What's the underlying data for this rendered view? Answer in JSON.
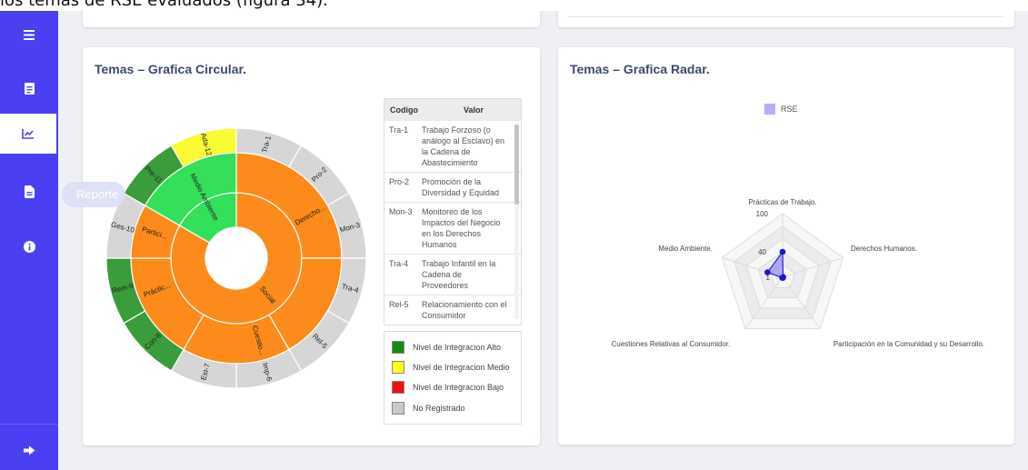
{
  "document": {
    "top_text": "los temas de RSE evaluados (figura 34)."
  },
  "sidebar": {
    "items": [
      {
        "icon": "menu-icon"
      },
      {
        "icon": "clipboard-icon"
      },
      {
        "icon": "chart-line-icon",
        "active": true
      },
      {
        "icon": "file-icon"
      },
      {
        "icon": "info-icon"
      }
    ],
    "logout_icon": "sign-out-icon",
    "tooltip": "Reporte"
  },
  "circular_card": {
    "title": "Temas – Grafica Circular.",
    "legend_table": {
      "headers": {
        "code": "Codigo",
        "value": "Valor"
      },
      "rows": [
        {
          "code": "Tra-1",
          "value": "Trabajo Forzoso (o análogo al Esclavo) en la Cadena de Abastecimiento"
        },
        {
          "code": "Pro-2",
          "value": "Promoción de la Diversidad y Equidad"
        },
        {
          "code": "Mon-3",
          "value": "Monitoreo de los Impactos del Negocio en los Derechos Humanos"
        },
        {
          "code": "Tra-4",
          "value": "Trabajo Infantil en la Cadena de Proveedores"
        },
        {
          "code": "Rel-5",
          "value": "Relacionamiento con el Consumidor"
        }
      ]
    },
    "levels": [
      {
        "label": "Nivel de Integracion Alto",
        "color": "#138a13"
      },
      {
        "label": "Nivel de Integracion Medio",
        "color": "#ffff22"
      },
      {
        "label": "Nivel de Integracion Bajo",
        "color": "#ee1111"
      },
      {
        "label": "No Registrado",
        "color": "#c8c8c8"
      }
    ],
    "inner_ring": [
      {
        "label": "Social"
      }
    ],
    "middle_ring": [
      {
        "label": "Medio Ambiente"
      },
      {
        "label": "Derecho..."
      },
      {
        "label": "Cuestio..."
      },
      {
        "label": "Práctic..."
      },
      {
        "label": "Partici..."
      }
    ],
    "outer_ring": [
      {
        "label": "Tra-1"
      },
      {
        "label": "Pro-2"
      },
      {
        "label": "Mon-3"
      },
      {
        "label": "Tra-4"
      },
      {
        "label": "Rel-5"
      },
      {
        "label": "Imp-6"
      },
      {
        "label": "Est-7"
      },
      {
        "label": "Con-8"
      },
      {
        "label": "Rem-9"
      },
      {
        "label": "Ges-10"
      },
      {
        "label": "Pre-11"
      },
      {
        "label": "Ada-12"
      }
    ],
    "colors": {
      "orange": "#fc8b1c",
      "bright_green": "#34e05a",
      "dark_green": "#3a9c3a",
      "grey": "#d6d6d6",
      "yellow": "#fbfb34"
    }
  },
  "radar_card": {
    "title": "Temas – Grafica Radar.",
    "legend_label": "RSE",
    "legend_color": "#b3b0f7",
    "axis_labels": [
      "Prácticas de Trabajo.",
      "Derechos Humanos.",
      "Participación en la Comunidad y su Desarrollo.",
      "Cuestiones Relativas al Consumidor.",
      "Medio Ambiente."
    ],
    "tick_labels": [
      "100",
      "40",
      "1"
    ]
  }
}
